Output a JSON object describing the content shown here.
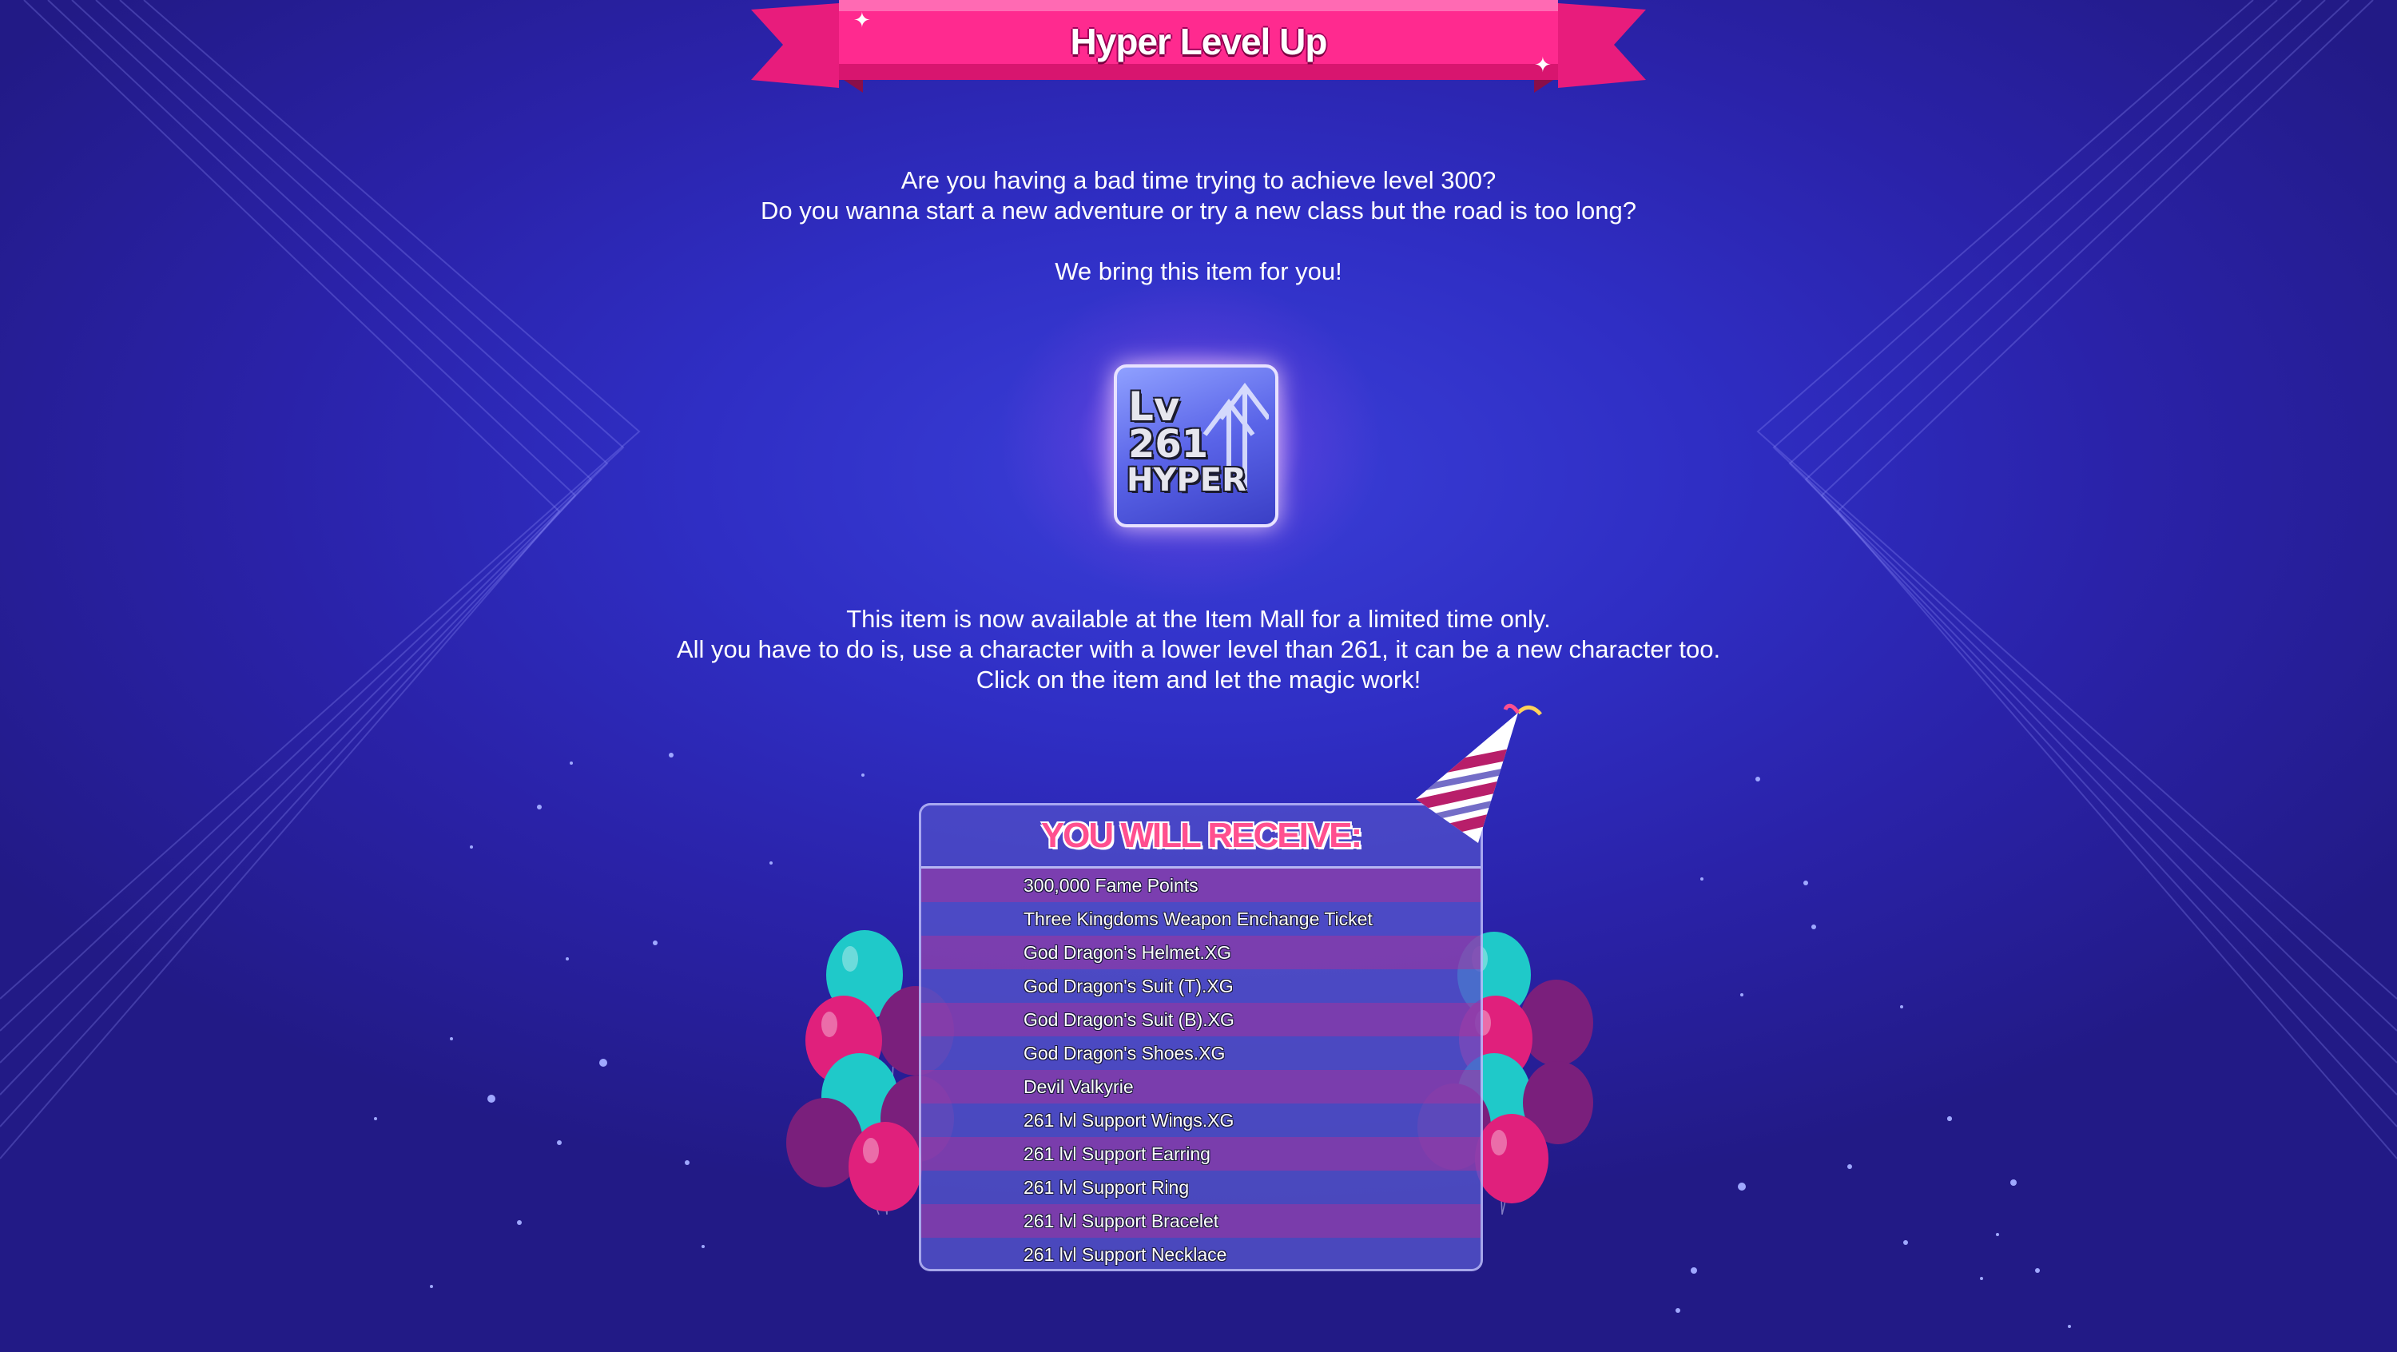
{
  "banner": {
    "title": "Hyper Level Up"
  },
  "intro": {
    "line1": "Are you having a bad time trying to achieve level 300?",
    "line2": "Do you wanna start a new adventure or try a new class but the road is too long?",
    "line3": "We bring this item for you!"
  },
  "item": {
    "name_line1": "Lv",
    "name_line2": "261",
    "name_line3": "HYPER",
    "icon": "level-up-arrows-icon"
  },
  "availability": {
    "line1": "This item is now available at the Item Mall for a limited time only.",
    "line2": "All you have to do is, use a character with a lower level than 261, it can be a new character too.",
    "line3": "Click on the item and let the magic work!"
  },
  "rewards": {
    "title": "YOU WILL RECEIVE:",
    "items": [
      "300,000 Fame Points",
      "Three Kingdoms Weapon Enchange Ticket",
      "God Dragon's Helmet.XG",
      "God Dragon's Suit (T).XG",
      "God Dragon's Suit (B).XG",
      "God Dragon's Shoes.XG",
      "Devil Valkyrie",
      "261 lvl Support Wings.XG",
      "261 lvl Support Earring",
      "261 lvl Support Ring",
      "261 lvl Support Bracelet",
      "261 lvl Support Necklace"
    ]
  },
  "colors": {
    "background": "#2f2ec4",
    "banner_pink": "#ff1f8a",
    "receive_title": "#ff4f8f",
    "row_odd": "#8c3caa",
    "row_even": "#5050c8"
  },
  "decor": [
    "party-hat-icon",
    "balloons-left-icon",
    "balloons-right-icon",
    "sparkle-icon"
  ]
}
